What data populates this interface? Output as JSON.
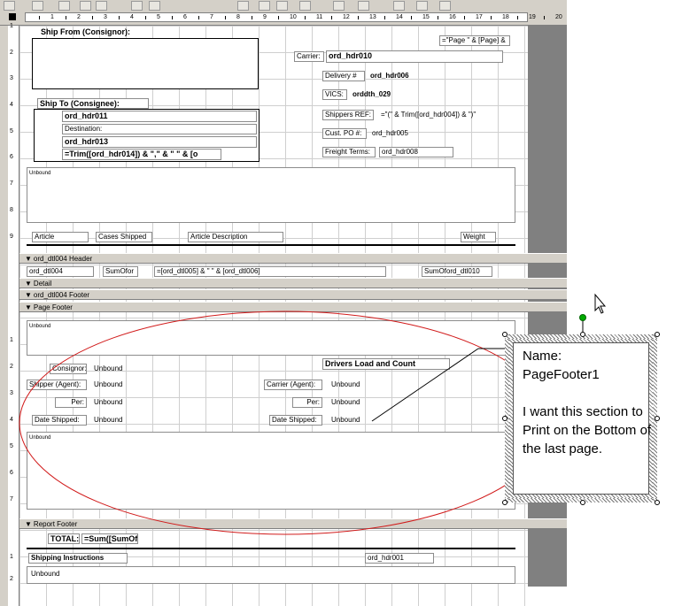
{
  "ruler": {
    "marks": [
      "1",
      "2",
      "3",
      "4",
      "5",
      "6",
      "7",
      "8",
      "9",
      "10",
      "11",
      "12",
      "13",
      "14",
      "15",
      "16",
      "17",
      "18",
      "19",
      "20"
    ],
    "vmarks": [
      "1",
      "2",
      "3",
      "4",
      "5",
      "6",
      "7",
      "8",
      "9",
      "1",
      "2",
      "3",
      "4",
      "5",
      "6",
      "7",
      "1",
      "2"
    ]
  },
  "page_header": {
    "ship_from_label": "Ship From (Consignor):",
    "page_expr": "=\"Page \" & [Page] &",
    "carrier_label": "Carrier:",
    "carrier_field": "ord_hdr010",
    "delivery_label": "Delivery #",
    "delivery_field": "ord_hdr006",
    "vics_label": "VICS:",
    "vics_field": "orddth_029",
    "ship_to_label": "Ship To (Consignee):",
    "shipto_field1": "ord_hdr011",
    "destination_label": "Destination:",
    "shipto_field2": "ord_hdr013",
    "shipto_expr": "=Trim([ord_hdr014]) & \",\" & \"  \" & [o",
    "shippers_ref_label": "Shippers REF:",
    "shippers_ref_expr": "=\"(\" & Trim([ord_hdr004]) & \")\"",
    "cust_po_label": "Cust. PO #:",
    "cust_po_field": "ord_hdr005",
    "freight_label": "Freight Terms:",
    "freight_field": "ord_hdr008",
    "unbound_label": "Unbound",
    "col_article": "Article",
    "col_cases": "Cases Shipped",
    "col_desc": "Article Description",
    "col_weight": "Weight"
  },
  "bands": {
    "group_header": "ord_dtl004 Header",
    "detail": "Detail",
    "group_footer": "ord_dtl004 Footer",
    "page_footer": "Page Footer",
    "report_footer": "Report Footer"
  },
  "group_header": {
    "field1": "ord_dtl004",
    "field2": "SumOfor",
    "field3": "=[ord_dtl005] & \"  \" & [ord_dtl006]",
    "field4": "SumOford_dtl010"
  },
  "page_footer": {
    "unbound_top": "Unbound",
    "drivers_title": "Drivers Load and Count",
    "consignor_label": "Consignor:",
    "consignor_field": "Unbound",
    "shipper_label": "Shipper (Agent):",
    "shipper_field": "Unbound",
    "carrier_agent_label": "Carrier (Agent):",
    "carrier_agent_field": "Unbound",
    "per_label1": "Per:",
    "per_field1": "Unbound",
    "per_label2": "Per:",
    "per_field2": "Unbound",
    "date_label1": "Date Shipped:",
    "date_field1": "Unbound",
    "date_label2": "Date Shipped:",
    "date_field2": "Unbound",
    "unbound_bottom": "Unbound"
  },
  "report_footer": {
    "total_label": "TOTAL:",
    "total_expr": "=Sum([SumOf",
    "instructions_label": "Shipping Instructions",
    "instructions_field": "ord_hdr001",
    "unbound": "Unbound"
  },
  "annotation": {
    "line1": "Name:",
    "line2": "PageFooter1",
    "line3": "I want this section to Print on the Bottom of the last page."
  },
  "colors": {
    "ellipse": "#d11a1a",
    "band": "#d4d0c8",
    "grid": "#cfcfcf",
    "handle": "#00aa00"
  }
}
